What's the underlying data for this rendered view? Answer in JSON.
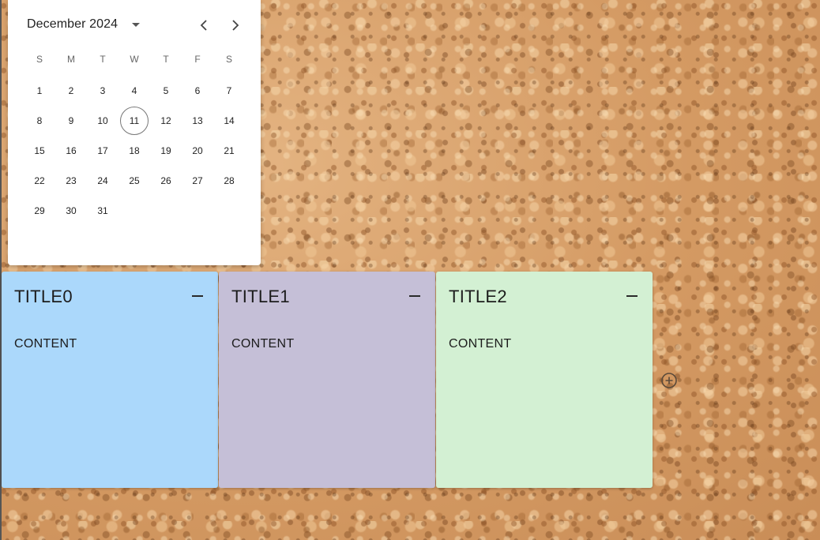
{
  "calendar": {
    "month_label": "December 2024",
    "weekdays": [
      "S",
      "M",
      "T",
      "W",
      "T",
      "F",
      "S"
    ],
    "weeks": [
      [
        "1",
        "2",
        "3",
        "4",
        "5",
        "6",
        "7"
      ],
      [
        "8",
        "9",
        "10",
        "11",
        "12",
        "13",
        "14"
      ],
      [
        "15",
        "16",
        "17",
        "18",
        "19",
        "20",
        "21"
      ],
      [
        "22",
        "23",
        "24",
        "25",
        "26",
        "27",
        "28"
      ],
      [
        "29",
        "30",
        "31",
        "",
        "",
        "",
        ""
      ]
    ],
    "today": "11",
    "icons": {
      "dropdown": "arrow-drop-down-icon",
      "prev": "chevron-left-icon",
      "next": "chevron-right-icon"
    }
  },
  "notes": [
    {
      "title": "TITLE0",
      "content": "CONTENT",
      "color": "#abd8fb"
    },
    {
      "title": "TITLE1",
      "content": "CONTENT",
      "color": "#c5bfd7"
    },
    {
      "title": "TITLE2",
      "content": "CONTENT",
      "color": "#d3f0d3"
    }
  ],
  "icons": {
    "minimize": "minimize-icon",
    "add": "add-circle-icon"
  },
  "colors": {
    "cork_background": "#d9a471",
    "calendar_background": "#ffffff",
    "today_ring": "#777777"
  }
}
